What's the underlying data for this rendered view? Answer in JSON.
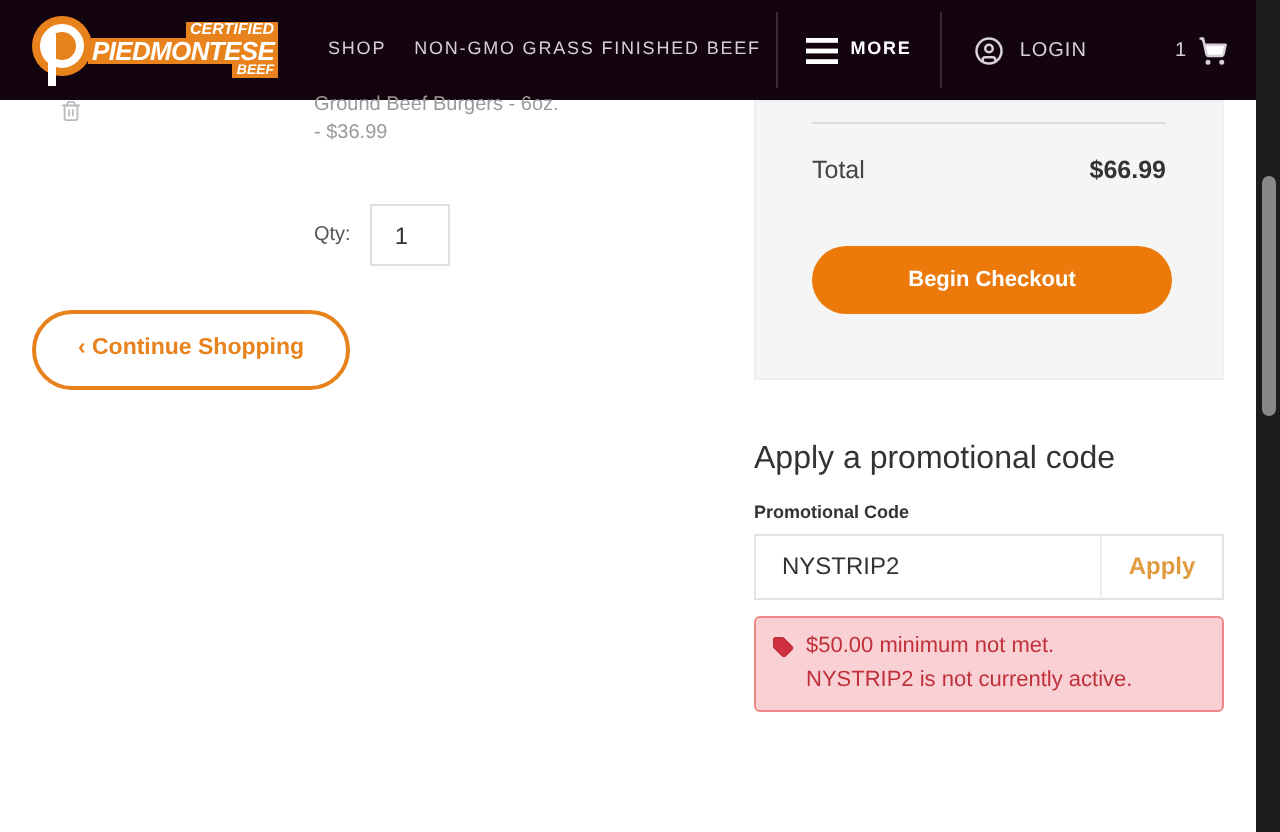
{
  "header": {
    "logo": {
      "top": "CERTIFIED",
      "main": "PIEDMONTESE",
      "bottom": "BEEF"
    },
    "nav": [
      "SHOP",
      "NON-GMO GRASS FINISHED BEEF"
    ],
    "more": "MORE",
    "login": "LOGIN",
    "cart_count": "1"
  },
  "cart_item": {
    "name": "Ground Beef Burgers - 6oz.",
    "price": "- $36.99",
    "qty_label": "Qty:",
    "qty": "1"
  },
  "continue_button": "‹ Continue Shopping",
  "summary": {
    "total_label": "Total",
    "total": "$66.99",
    "checkout_button": "Begin Checkout"
  },
  "promo": {
    "heading": "Apply a promotional code",
    "label": "Promotional Code",
    "value": "NYSTRIP2",
    "apply_button": "Apply",
    "errors": [
      "$50.00 minimum not met.",
      "NYSTRIP2 is not currently active."
    ]
  }
}
